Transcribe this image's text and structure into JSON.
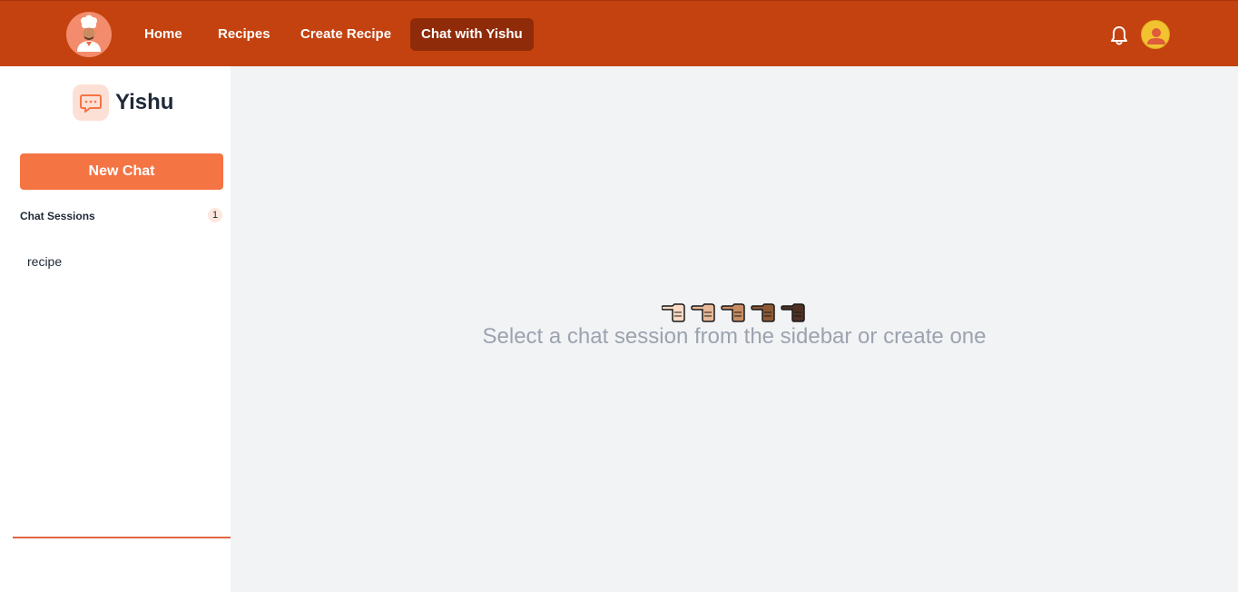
{
  "nav": {
    "items": [
      {
        "label": "Home",
        "active": false
      },
      {
        "label": "Recipes",
        "active": false
      },
      {
        "label": "Create Recipe",
        "active": false
      },
      {
        "label": "Chat with Yishu",
        "active": true
      }
    ],
    "icons": {
      "logo": "chef-logo",
      "notifications": "bell-icon",
      "profile": "user-avatar"
    }
  },
  "sidebar": {
    "brand_icon": "chat-bubble-icon",
    "brand_name": "Yishu",
    "new_chat_label": "New Chat",
    "sessions_title": "Chat Sessions",
    "sessions_count": "1",
    "sessions": [
      {
        "title": "recipe"
      }
    ]
  },
  "main": {
    "hands_icon": "pointing-left-hands-icon",
    "empty_message": "Select a chat session from the sidebar or create one"
  },
  "colors": {
    "topbar": "#c4420f",
    "active_nav": "#8f2b09",
    "accent": "#f47444",
    "main_bg": "#f2f3f5",
    "muted_text": "#9ca3af"
  }
}
